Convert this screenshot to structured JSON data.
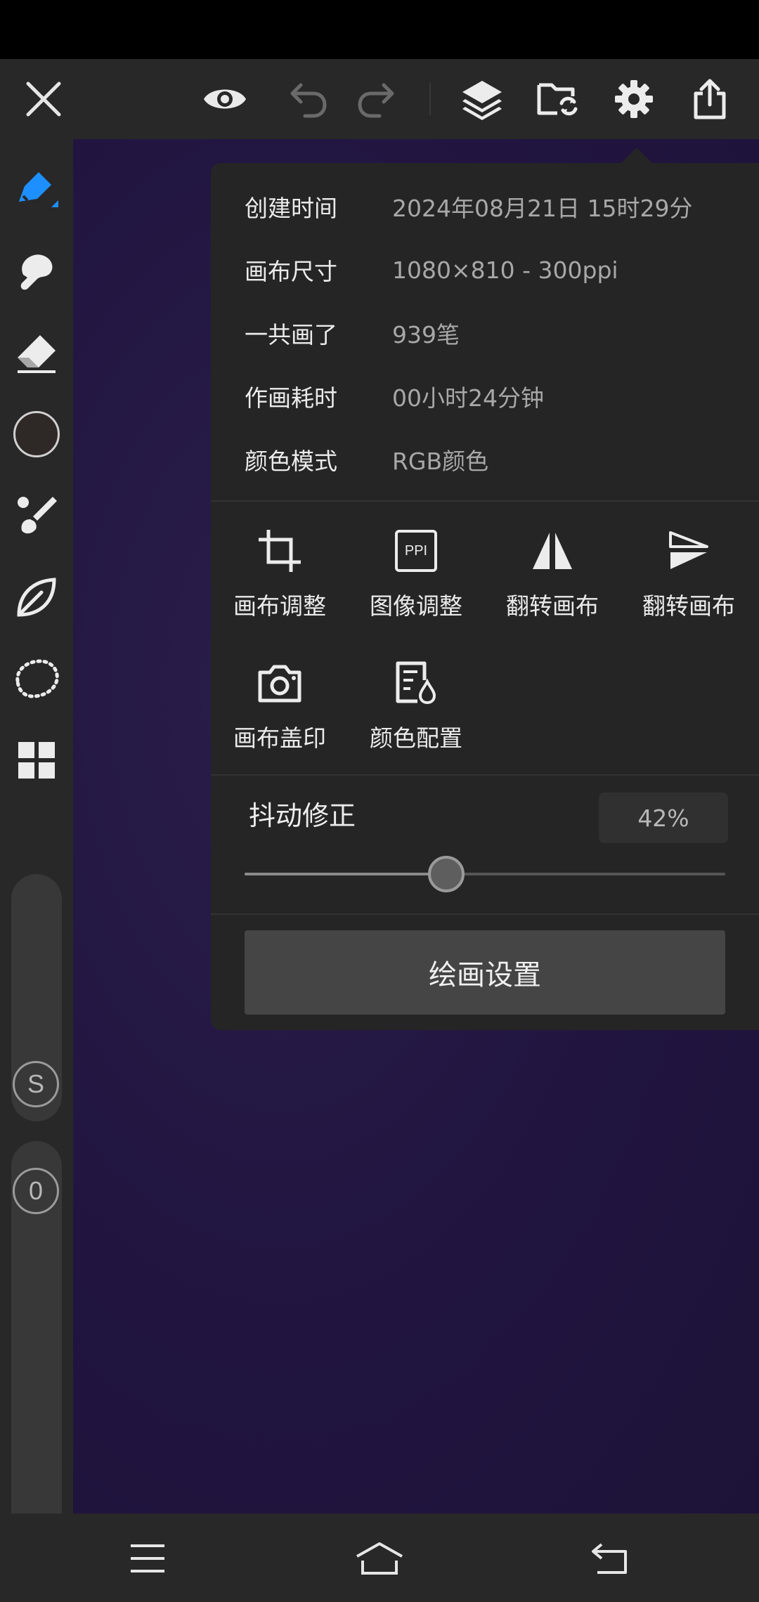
{
  "popover": {
    "info": [
      {
        "label": "创建时间",
        "value": "2024年08月21日 15时29分"
      },
      {
        "label": "画布尺寸",
        "value": "1080×810 - 300ppi"
      },
      {
        "label": "一共画了",
        "value": "939笔"
      },
      {
        "label": "作画耗时",
        "value": "00小时24分钟"
      },
      {
        "label": "颜色模式",
        "value": "RGB颜色"
      }
    ],
    "actions": [
      {
        "label": "画布调整",
        "icon": "crop-icon"
      },
      {
        "label": "图像调整",
        "icon": "ppi-icon",
        "icon_text": "PPI"
      },
      {
        "label": "翻转画布",
        "icon": "flip-horizontal-icon"
      },
      {
        "label": "翻转画布",
        "icon": "flip-vertical-icon"
      },
      {
        "label": "画布盖印",
        "icon": "camera-icon"
      },
      {
        "label": "颜色配置",
        "icon": "color-profile-icon"
      }
    ],
    "stabilizer": {
      "label": "抖动修正",
      "value_text": "42%",
      "value": 0.42
    },
    "paint_settings_label": "绘画设置"
  },
  "sidebar": {
    "badge_s": "S",
    "badge_0": "0",
    "current_color": "#2e2826"
  },
  "colors": {
    "accent": "#1e8fff",
    "panel": "#252525",
    "toolbar": "#282828",
    "canvas": "#211540"
  }
}
